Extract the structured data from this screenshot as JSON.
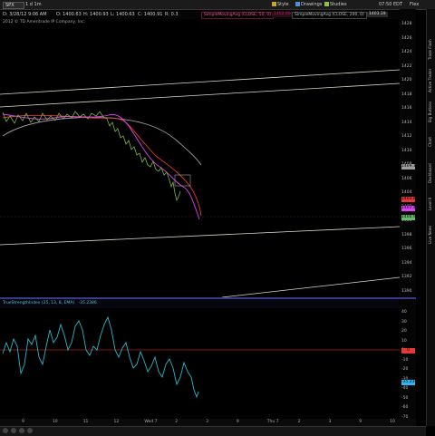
{
  "toolbar": {
    "symbol": "SPX",
    "period": "1 d 1m",
    "right_items": [
      {
        "label": "Style",
        "icon": "style-icon"
      },
      {
        "label": "Drawings",
        "icon": "drawings-icon"
      },
      {
        "label": "Studies",
        "icon": "studies-icon"
      }
    ],
    "clock": "07:50 EDT",
    "flex_label": "Flex"
  },
  "quote": {
    "date_time": "D: 3/28/12 9:06 AM",
    "open": "O: 1400.63",
    "high": "H: 1400.93",
    "low": "L: 1400.63",
    "close": "C: 1400.91",
    "change": "R: 0.3",
    "studies": [
      {
        "label": "SimpleMovingAvg (CLOSE, 50, 0)",
        "value": "1402.90",
        "color": "#c2185b"
      },
      {
        "label": "SimpleMovingAvg (CLOSE, 200, 0)",
        "value": "1403.19",
        "color": "#9e9e9e"
      }
    ],
    "last_price": "1400.93"
  },
  "copyright": "2012 © TD Ameritrade IP Company, Inc.",
  "price_axis": {
    "ticks": [
      "1428",
      "1426",
      "1424",
      "1422",
      "1420",
      "1418",
      "1416",
      "1414",
      "1412",
      "1410",
      "1408",
      "1406",
      "1404",
      "1402",
      "1400",
      "1398",
      "1396",
      "1394",
      "1392",
      "1390"
    ],
    "badges": [
      {
        "label": "1409.19",
        "color": "#9e9e9e"
      },
      {
        "label": "1403.88",
        "color": "#e53935"
      },
      {
        "label": "1402.46",
        "color": "#e040fb"
      },
      {
        "label": "1400.93",
        "color": "#66bb6a"
      }
    ]
  },
  "indicator": {
    "title": "TrueStrengthIndex (25, 13, 8, EMA)",
    "value_text": "-35.2386",
    "ticks": [
      "40",
      "30",
      "20",
      "10",
      "0",
      "-10",
      "-20",
      "-30",
      "-40",
      "-50",
      "-60",
      "-70"
    ],
    "badges": [
      {
        "label": "0",
        "color": "#e53935"
      },
      {
        "label": "-35.238",
        "color": "#29b6f6"
      }
    ],
    "series_color": "#2bb7c8",
    "zero_line_color": "#b71c1c"
  },
  "time_axis": {
    "ticks": [
      "9",
      "10",
      "11",
      "12",
      "Wed 7",
      "2",
      "3",
      "9",
      "Thu 7",
      "2",
      "3",
      "9",
      "10"
    ]
  },
  "side_panel": {
    "tabs": [
      "Trade Flash",
      "Active Trader",
      "Big Buttons",
      "Chart",
      "Dashboard",
      "Level II",
      "Live News"
    ]
  }
}
